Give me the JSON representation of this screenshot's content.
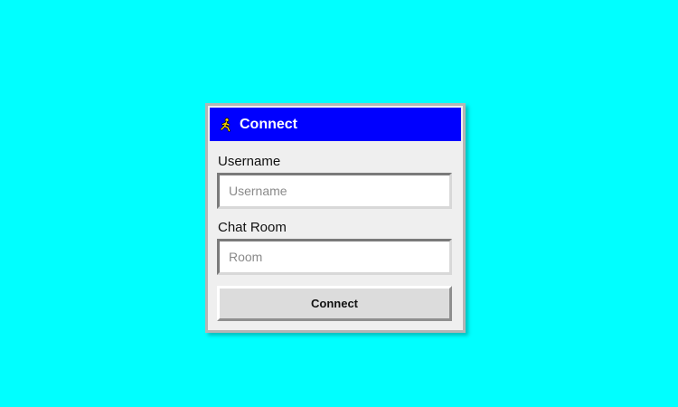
{
  "window": {
    "title": "Connect",
    "title_icon": "running-man-icon"
  },
  "form": {
    "username_label": "Username",
    "username_placeholder": "Username",
    "username_value": "",
    "room_label": "Chat Room",
    "room_placeholder": "Room",
    "room_value": "",
    "connect_label": "Connect"
  },
  "colors": {
    "background": "#00ffff",
    "titlebar": "#0000ff",
    "icon": "#ffd800"
  }
}
